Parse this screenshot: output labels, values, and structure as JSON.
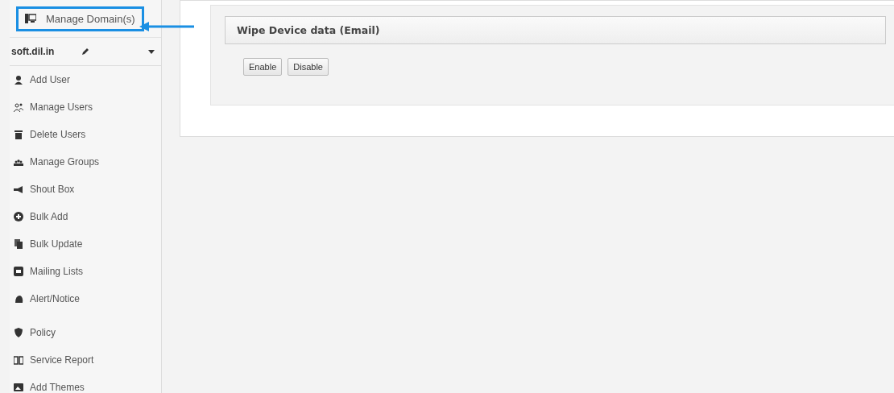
{
  "sidebar": {
    "header_link": {
      "label": "Manage Domain(s)",
      "highlighted": true
    },
    "domain": {
      "name": "soft.dil.in"
    },
    "items": [
      {
        "label": "Add User"
      },
      {
        "label": "Manage Users"
      },
      {
        "label": "Delete Users"
      },
      {
        "label": "Manage Groups"
      },
      {
        "label": "Shout Box"
      },
      {
        "label": "Bulk Add"
      },
      {
        "label": "Bulk Update"
      },
      {
        "label": "Mailing Lists"
      },
      {
        "label": "Alert/Notice"
      },
      {
        "label": "Policy"
      },
      {
        "label": "Service Report"
      },
      {
        "label": "Add Themes"
      }
    ]
  },
  "panel": {
    "title": "Wipe Device data (Email)",
    "buttons": [
      "Enable",
      "Disable"
    ]
  }
}
